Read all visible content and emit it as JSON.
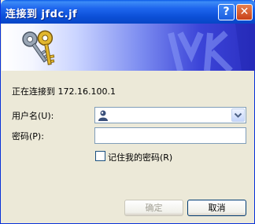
{
  "window": {
    "title": "连接到 jfdc.jf"
  },
  "titlebar": {
    "help_label": "?",
    "close_label": "✕"
  },
  "status": {
    "connecting_text": "正在连接到 172.16.100.1"
  },
  "form": {
    "username_label": "用户名(U):",
    "password_label": "密码(P):",
    "username_value": "",
    "password_value": "",
    "remember_label": "记住我的密码(R)"
  },
  "buttons": {
    "ok": "确定",
    "cancel": "取消"
  },
  "icons": {
    "banner": "keys-icon",
    "user": "user-icon",
    "dropdown": "chevron-down-icon"
  },
  "colors": {
    "title_bar": "#0a5ae8",
    "close_button": "#d9582b",
    "dialog_bg": "#ece9d8",
    "banner_dark": "#2b2fc2"
  }
}
